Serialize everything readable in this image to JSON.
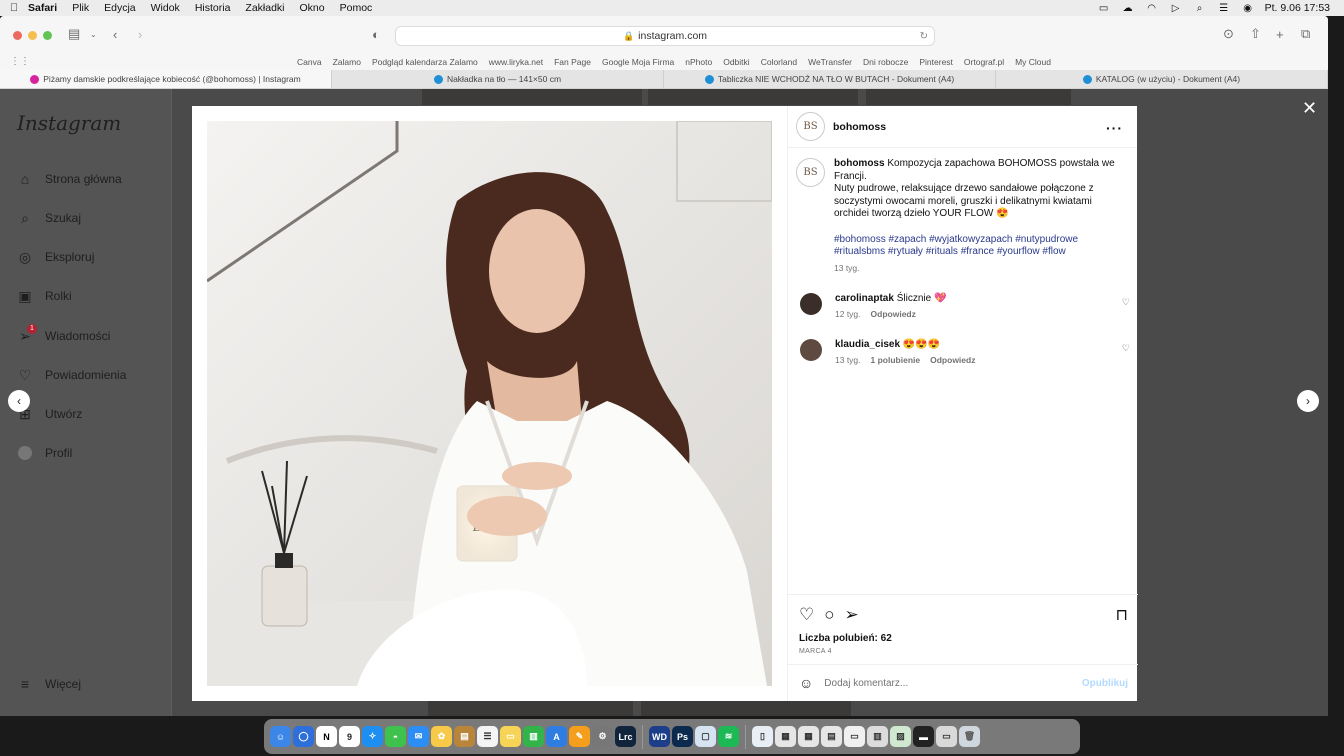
{
  "menubar": {
    "app": "Safari",
    "items": [
      "Plik",
      "Edycja",
      "Widok",
      "Historia",
      "Zakładki",
      "Okno",
      "Pomoc"
    ],
    "clock": "Pt. 9.06  17:53"
  },
  "browser": {
    "url": "instagram.com",
    "bookmarks": [
      "Canva",
      "Zalamo",
      "Podgląd kalendarza Zalamo",
      "www.liryka.net",
      "Fan Page",
      "Google Moja Firma",
      "nPhoto",
      "Odbitki",
      "Colorland",
      "WeTransfer",
      "Dni robocze",
      "Pinterest",
      "Ortograf.pl",
      "My Cloud"
    ],
    "tabs": [
      {
        "title": "Piżamy damskie podkreślające kobiecość (@bohomoss) | Instagram",
        "color": "#d6249f"
      },
      {
        "title": "Nakładka na tło — 141×50 cm",
        "color": "#1f8fd6"
      },
      {
        "title": "Tabliczka NIE WCHODŹ NA TŁO W BUTACH - Dokument (A4)",
        "color": "#1f8fd6"
      },
      {
        "title": "KATALOG (w użyciu) - Dokument (A4)",
        "color": "#1f8fd6"
      }
    ]
  },
  "sidebar": {
    "logo": "Instagram",
    "items": [
      {
        "label": "Strona główna",
        "icon": "home-icon"
      },
      {
        "label": "Szukaj",
        "icon": "search-icon"
      },
      {
        "label": "Eksploruj",
        "icon": "compass-icon"
      },
      {
        "label": "Rolki",
        "icon": "reels-icon"
      },
      {
        "label": "Wiadomości",
        "icon": "messenger-icon",
        "badge": "1"
      },
      {
        "label": "Powiadomienia",
        "icon": "heart-icon"
      },
      {
        "label": "Utwórz",
        "icon": "plus-icon"
      },
      {
        "label": "Profil",
        "icon": "avatar-icon"
      }
    ],
    "more": "Więcej"
  },
  "post": {
    "avatar_text": "BS",
    "username": "bohomoss",
    "caption_line1": "Kompozycja zapachowa BOHOMOSS powstała we Francji.",
    "caption_line2": "Nuty pudrowe, relaksujące drzewo sandałowe połączone z soczystymi owocami moreli, gruszki i delikatnymi kwiatami orchidei tworzą dzieło YOUR FLOW 😍",
    "hashtags": "#bohomoss #zapach #wyjatkowyzapach #nutypudrowe #ritualsbms #rytuały #rituals #france #yourflow #flow",
    "caption_time": "13 tyg.",
    "comments": [
      {
        "user": "carolinaptak",
        "text": "Ślicznie 💖",
        "time": "12 tyg.",
        "likes": "",
        "reply": "Odpowiedz"
      },
      {
        "user": "klaudia_cisek",
        "text": "😍😍😍",
        "time": "13 tyg.",
        "likes": "1 polubienie",
        "reply": "Odpowiedz"
      }
    ],
    "likes": "Liczba polubień: 62",
    "date": "MARCA 4",
    "comment_placeholder": "Dodaj komentarz...",
    "post_button": "Opublikuj"
  }
}
